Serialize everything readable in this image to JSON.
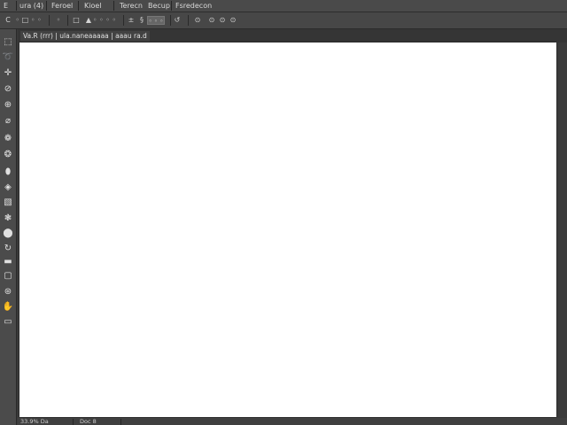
{
  "menubar": {
    "items": [
      {
        "label": "E"
      },
      {
        "label": "ura (4)"
      },
      {
        "label": "Feroel"
      },
      {
        "label": "Kioel"
      },
      {
        "label": "Terecn"
      },
      {
        "label": "Becup"
      },
      {
        "label": "Fsredecon"
      }
    ]
  },
  "options": {
    "items": [
      {
        "label": "C"
      },
      {
        "label": "◦ □ ◦ ◦"
      },
      {
        "label": "◦"
      },
      {
        "label": "□"
      },
      {
        "label": "▲"
      },
      {
        "label": "◦ ◦ ◦ ◦"
      },
      {
        "label": "±"
      },
      {
        "label": "§"
      },
      {
        "label": "↺"
      },
      {
        "label": "⊙"
      },
      {
        "label": "⊙"
      },
      {
        "label": "⊙"
      },
      {
        "label": "⊙"
      }
    ],
    "field": "◦ ◦ ◦"
  },
  "document": {
    "tab_label": "Va.R (rrr) | ula.naneaaaaa | aaau ra.d"
  },
  "tools": [
    {
      "icon": "marquee-icon",
      "glyph": "⬚"
    },
    {
      "icon": "lasso-icon",
      "glyph": "➰"
    },
    {
      "icon": "move-icon",
      "glyph": "✛"
    },
    {
      "icon": "magic-wand-icon",
      "glyph": "⊘"
    },
    {
      "icon": "crop-icon",
      "glyph": "⊕"
    },
    {
      "icon": "eyedropper-icon",
      "glyph": "⌀"
    },
    {
      "icon": "healing-brush-icon",
      "glyph": "❁"
    },
    {
      "icon": "brush-icon",
      "glyph": "❂"
    },
    {
      "icon": "stamp-icon",
      "glyph": "⬮"
    },
    {
      "icon": "history-brush-icon",
      "glyph": "◈"
    },
    {
      "icon": "eraser-icon",
      "glyph": "▧"
    },
    {
      "icon": "gradient-icon",
      "glyph": "❃"
    },
    {
      "icon": "blur-icon",
      "glyph": "⬤"
    },
    {
      "icon": "dodge-icon",
      "glyph": "↻"
    },
    {
      "icon": "pen-icon",
      "glyph": "▬"
    },
    {
      "icon": "type-icon",
      "glyph": "▢"
    },
    {
      "icon": "shape-icon",
      "glyph": "⊛"
    },
    {
      "icon": "hand-icon",
      "glyph": "✋"
    },
    {
      "icon": "zoom-icon",
      "glyph": "▭"
    }
  ],
  "status": {
    "zoom": "33.9% Da",
    "info": "Doc 8"
  },
  "colors": {
    "canvas": "#ffffff",
    "chrome": "#474747"
  }
}
